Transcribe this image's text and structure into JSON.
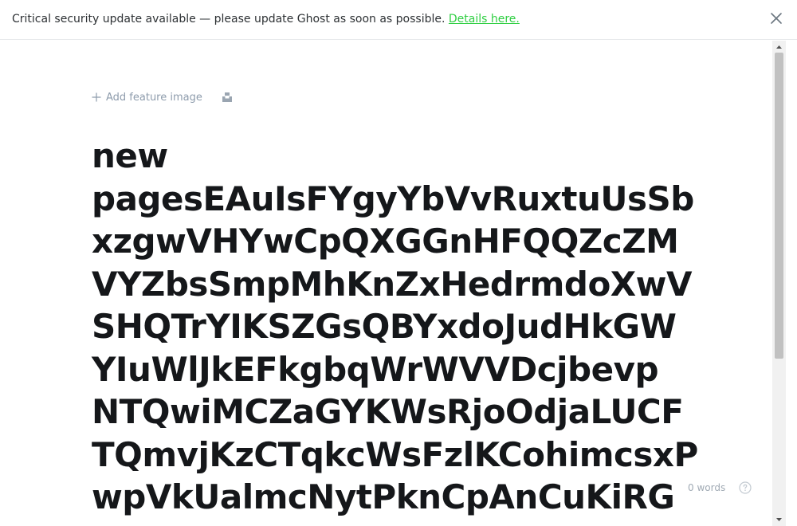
{
  "banner": {
    "message": "Critical security update available — please update Ghost as soon as possible.",
    "link_label": "Details here.",
    "close_icon": "close-icon"
  },
  "editor": {
    "add_feature_image_label": "Add feature image",
    "plus_icon": "plus-icon",
    "unsplash_icon": "unsplash-icon",
    "title_lines": [
      "new",
      "pagesEAuIsFYgyYbVvRuxtuUsSb",
      "xzgwVHYwCpQXGGnHFQQZcZM",
      "VYZbsSmpMhKnZxHedrmdoXwV",
      "SHQTrYIKSZGsQBYxdoJudHkGW",
      "YIuWlJkEFkgbqWrWVVDcjbevp",
      "NTQwiMCZaGYKWsRjoOdjaLUCF",
      "TQmvjKzCTqkcWsFzlKCohimcsxP",
      "wpVkUalmcNytPknCpAnCuKiRG"
    ],
    "word_count": "0 words",
    "help_icon": "question-circle-icon"
  },
  "colors": {
    "link": "#30cf43",
    "title": "#15171a",
    "muted": "#8e9cac"
  }
}
